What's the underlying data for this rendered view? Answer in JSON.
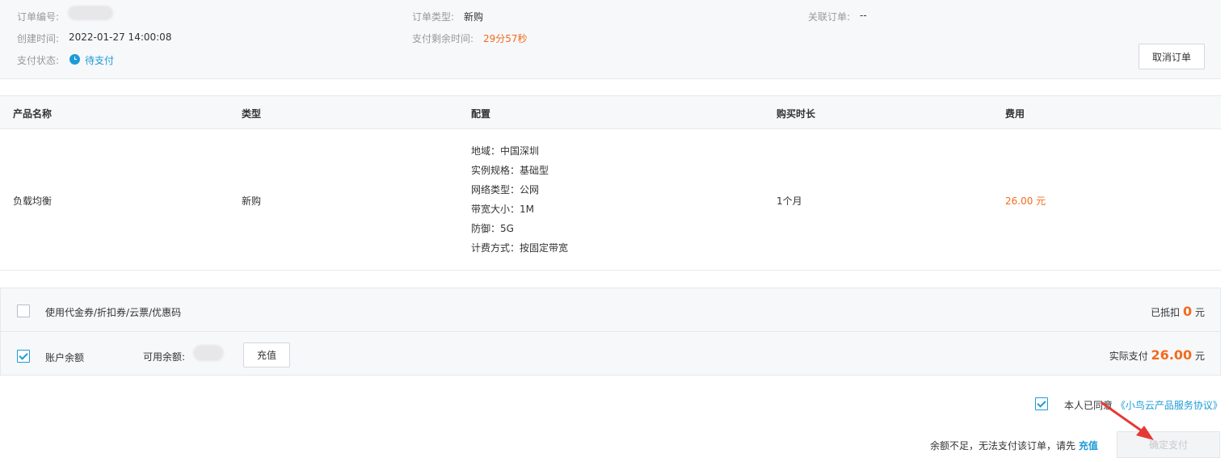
{
  "order_info": {
    "order_no_label": "订单编号:",
    "order_type_label": "订单类型:",
    "order_type_value": "新购",
    "related_order_label": "关联订单:",
    "related_order_value": "--",
    "created_label": "创建时间:",
    "created_value": "2022-01-27 14:00:08",
    "remaining_label": "支付剩余时间:",
    "remaining_value": "29分57秒",
    "status_label": "支付状态:",
    "status_value": "待支付",
    "cancel_button": "取消订单"
  },
  "table": {
    "headers": [
      "产品名称",
      "类型",
      "配置",
      "购买时长",
      "费用"
    ],
    "row": {
      "product": "负载均衡",
      "type": "新购",
      "config": [
        "地域：中国深圳",
        "实例规格：基础型",
        "网络类型：公网",
        "带宽大小：1M",
        "防御：5G",
        "计费方式：按固定带宽"
      ],
      "duration": "1个月",
      "fee": "26.00 元"
    }
  },
  "payment": {
    "coupon_label": "使用代金券/折扣券/云票/优惠码",
    "deducted_label": "已抵扣",
    "deducted_value": "0",
    "deducted_unit": "元",
    "balance_label": "账户余额",
    "available_label": "可用余额:",
    "recharge_button": "充值",
    "actual_label": "实际支付",
    "actual_value": "26.00",
    "actual_unit": "元",
    "coupon_checked": false,
    "balance_checked": true
  },
  "footer": {
    "agree_label": "本人已同意",
    "agreement_link": "《小鸟云产品服务协议》",
    "insufficient_text": "余额不足，无法支付该订单，请先",
    "recharge_link": "充值",
    "confirm_button": "确定支付",
    "agree_checked": true
  },
  "colors": {
    "accent_blue": "#1e9bd7",
    "price_orange": "#f26b1d",
    "annotation_arrow": "#e53935"
  }
}
